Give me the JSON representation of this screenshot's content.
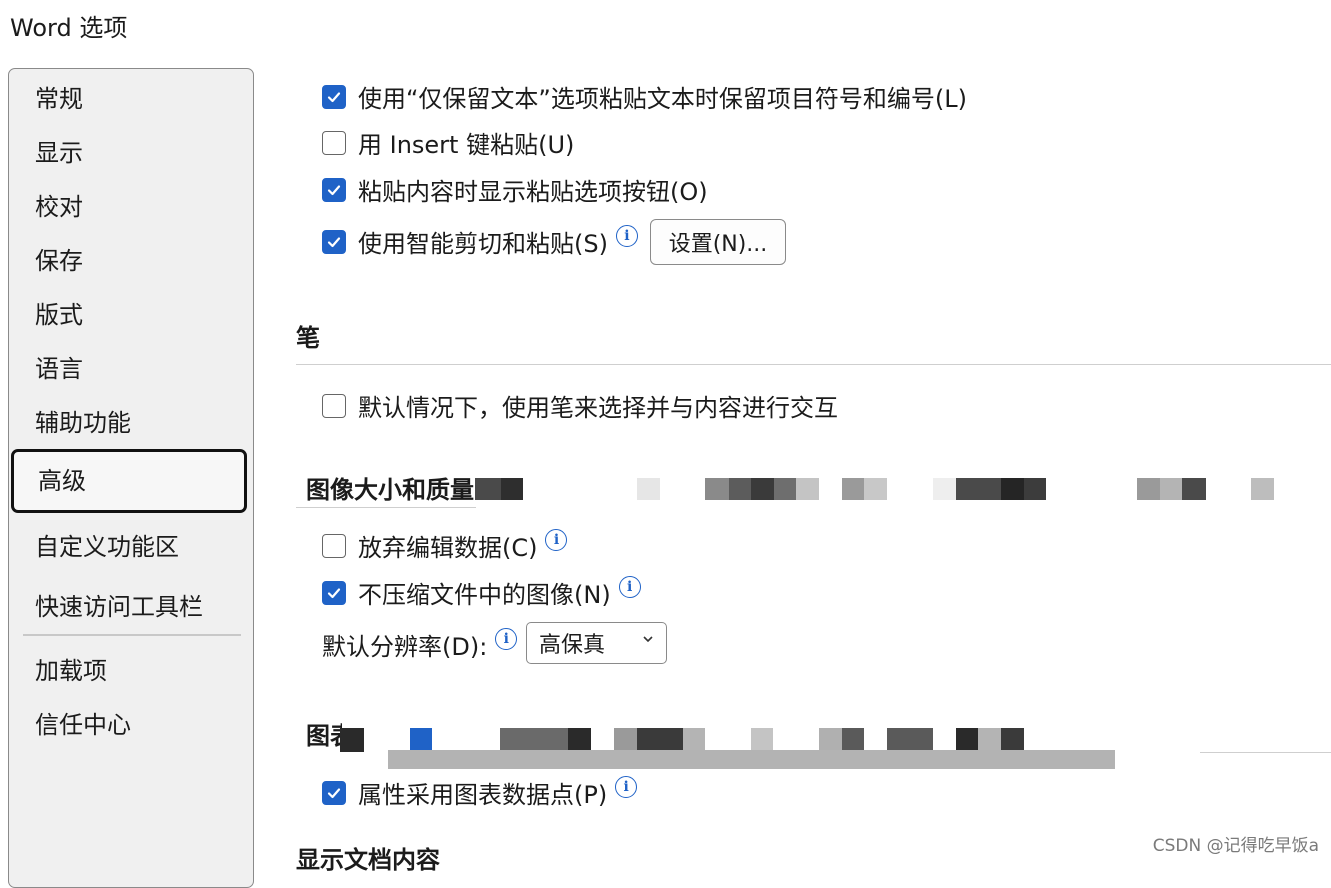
{
  "window": {
    "title": "Word 选项"
  },
  "sidebar": {
    "items": [
      {
        "label": "常规"
      },
      {
        "label": "显示"
      },
      {
        "label": "校对"
      },
      {
        "label": "保存"
      },
      {
        "label": "版式"
      },
      {
        "label": "语言"
      },
      {
        "label": "辅助功能"
      },
      {
        "label": "高级",
        "selected": true
      },
      {
        "label": "自定义功能区"
      },
      {
        "label": "快速访问工具栏"
      },
      {
        "label": "加载项"
      },
      {
        "label": "信任中心"
      }
    ]
  },
  "paste": {
    "keep_bullets": {
      "label": "使用“仅保留文本”选项粘贴文本时保留项目符号和编号(L)",
      "checked": true
    },
    "insert_key": {
      "label": "用 Insert 键粘贴(U)",
      "checked": false
    },
    "show_paste_btn": {
      "label": "粘贴内容时显示粘贴选项按钮(O)",
      "checked": true
    },
    "smart_cut": {
      "label": "使用智能剪切和粘贴(S)",
      "checked": true
    },
    "settings_button": "设置(N)..."
  },
  "pen": {
    "heading": "笔",
    "use_pen": {
      "label": "默认情况下，使用笔来选择并与内容进行交互",
      "checked": false
    }
  },
  "image": {
    "heading": "图像大小和质量",
    "discard_edit": {
      "label": "放弃编辑数据(C)",
      "checked": false
    },
    "no_compress": {
      "label": "不压缩文件中的图像(N)",
      "checked": true
    },
    "resolution_label": "默认分辨率(D):",
    "resolution_value": "高保真"
  },
  "chart": {
    "heading": "图表",
    "follow_points": {
      "label": "属性采用图表数据点(P)",
      "checked": true
    }
  },
  "display": {
    "heading": "显示文档内容"
  },
  "watermark": "CSDN @记得吃早饭a",
  "colors": {
    "accent": "#1f62c7"
  },
  "icons": {
    "check": "check-icon",
    "info": "info-icon",
    "dropdown": "chevron-down-icon"
  }
}
